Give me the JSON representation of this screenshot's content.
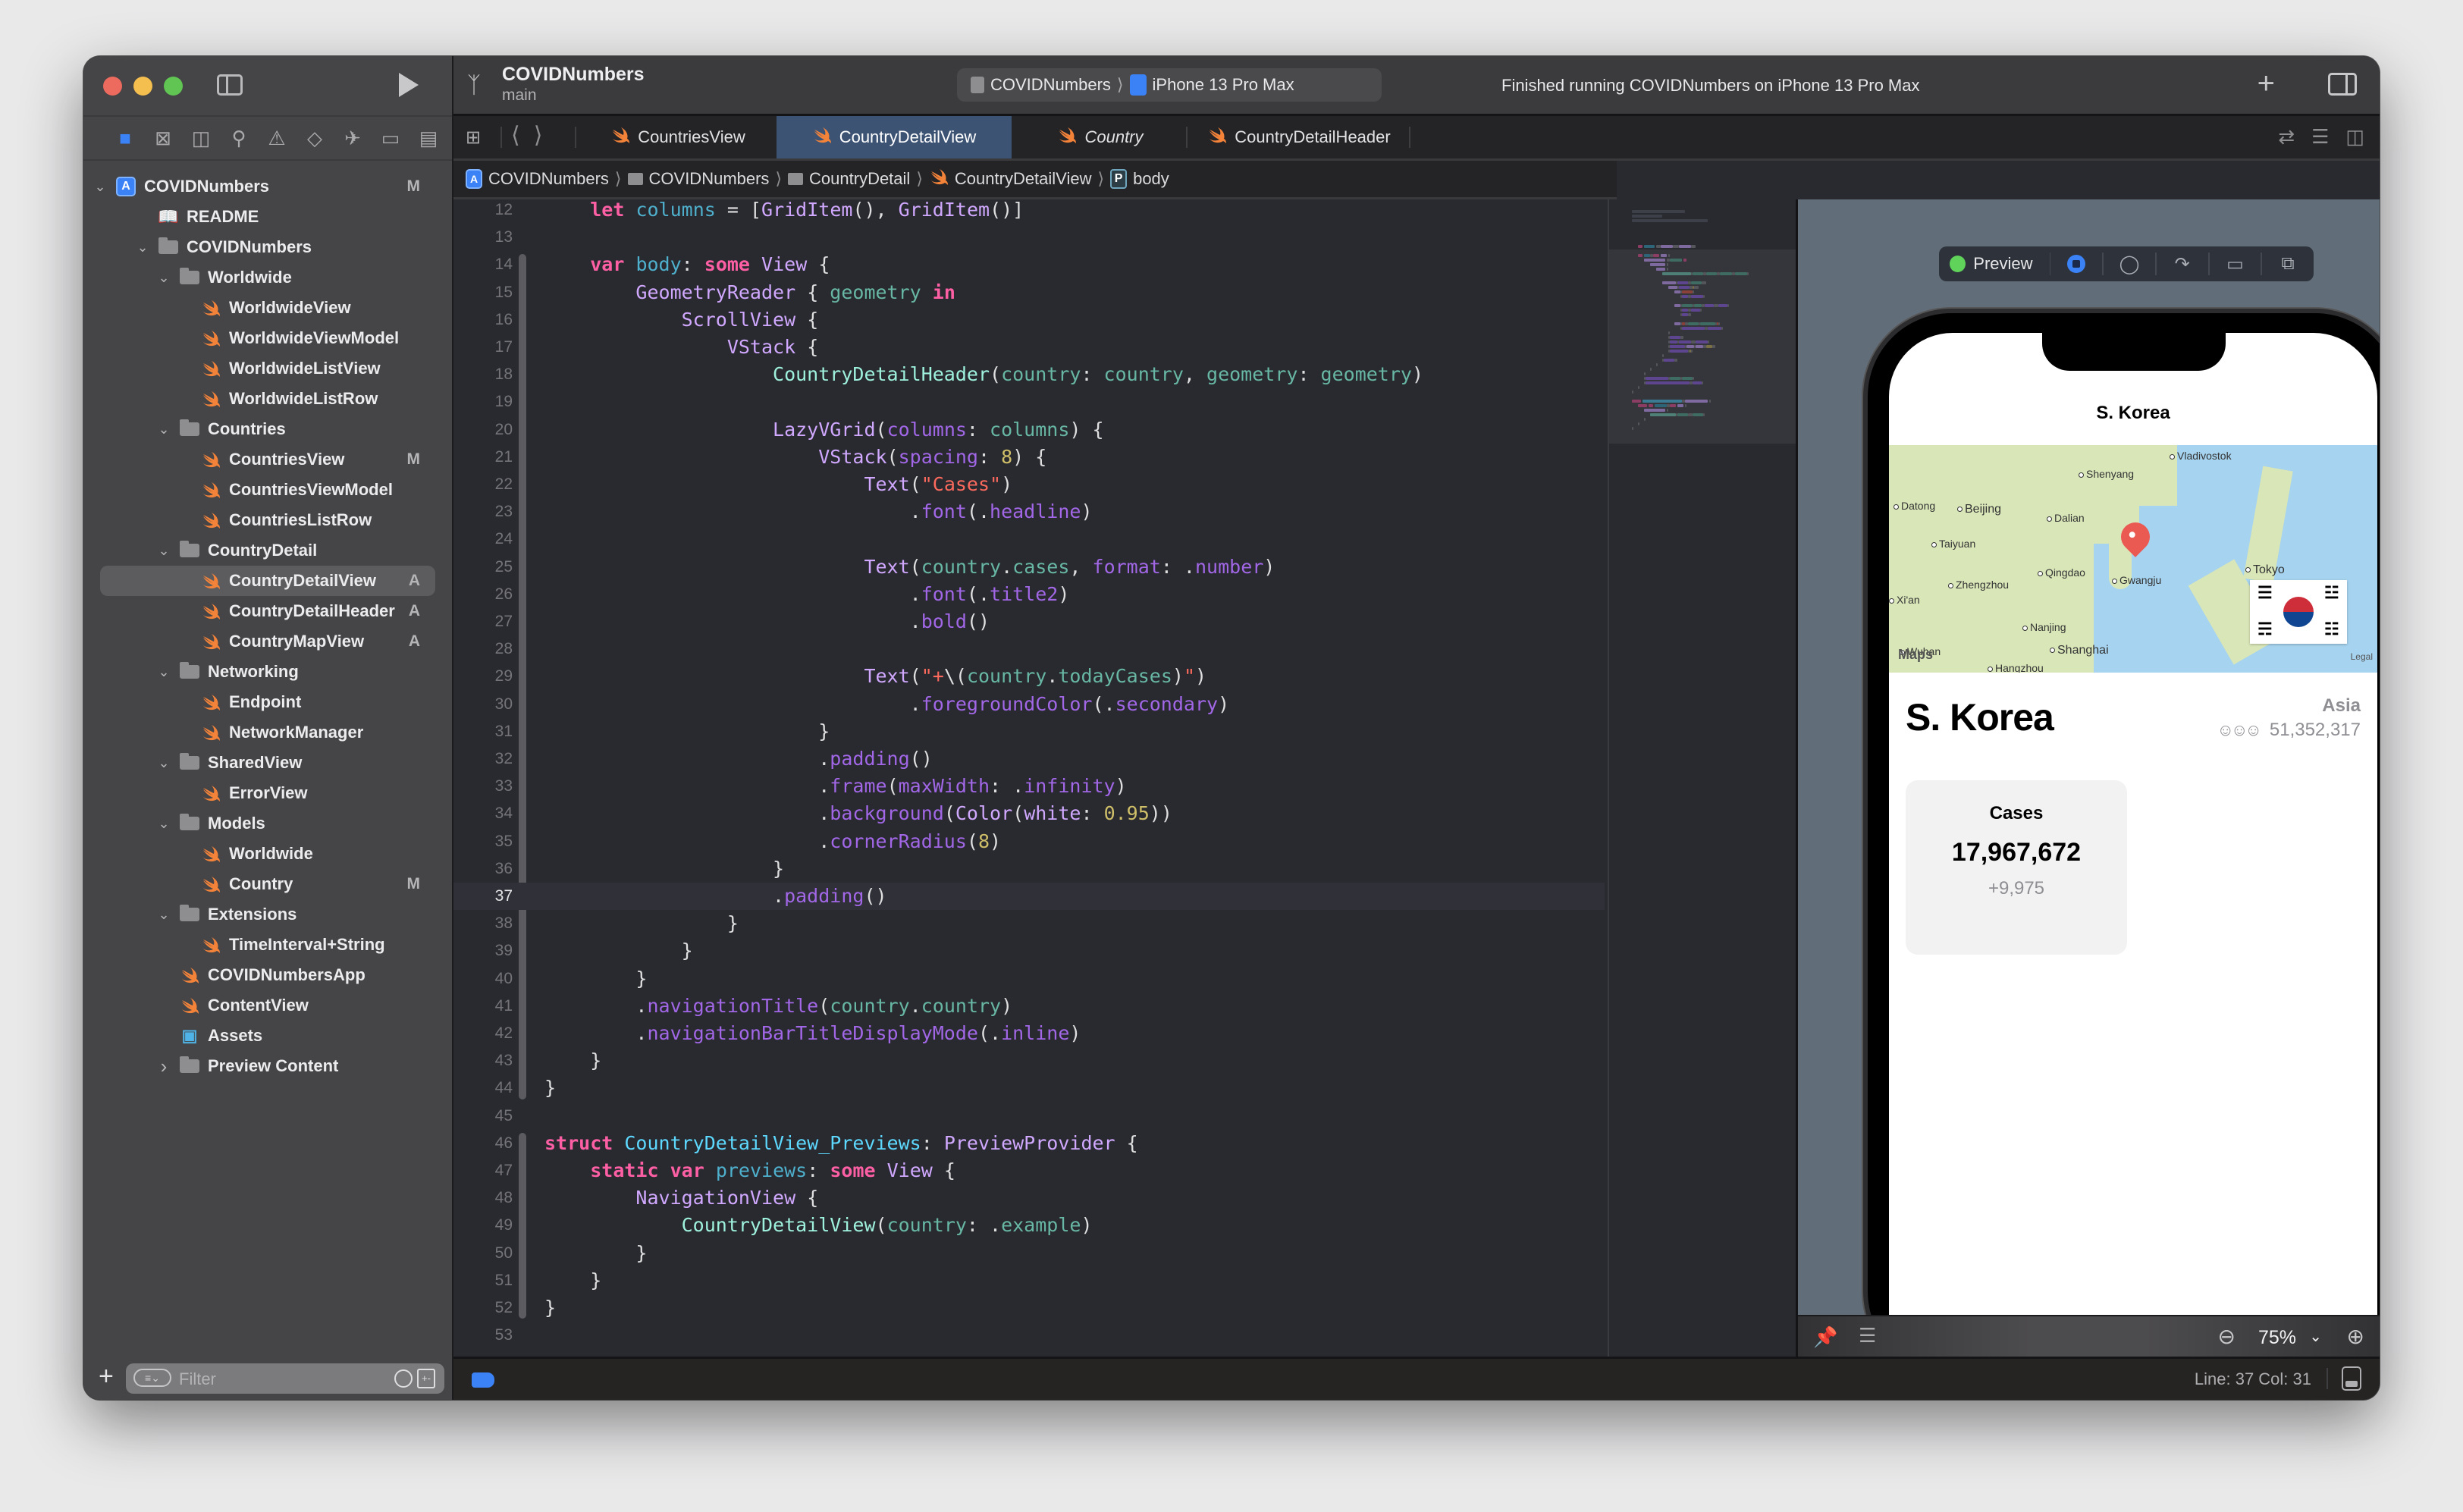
{
  "window": {
    "project_title": "COVIDNumbers",
    "branch": "main",
    "scheme": {
      "project": "COVIDNumbers",
      "device": "iPhone 13 Pro Max"
    },
    "activity_status": "Finished running COVIDNumbers on iPhone 13 Pro Max"
  },
  "navigator": {
    "icons": [
      "folder-icon",
      "source-control-icon",
      "symbol-icon",
      "find-icon",
      "issue-icon",
      "test-icon",
      "debug-icon",
      "breakpoint-icon",
      "report-icon"
    ],
    "tree": [
      {
        "label": "COVIDNumbers",
        "type": "project",
        "level": 0,
        "expanded": true,
        "badge": "M"
      },
      {
        "label": "README",
        "type": "book",
        "level": 1,
        "badge": ""
      },
      {
        "label": "COVIDNumbers",
        "type": "folder",
        "level": 1,
        "expanded": true,
        "badge": ""
      },
      {
        "label": "Worldwide",
        "type": "folder",
        "level": 2,
        "expanded": true,
        "badge": ""
      },
      {
        "label": "WorldwideView",
        "type": "swift",
        "level": 3,
        "badge": ""
      },
      {
        "label": "WorldwideViewModel",
        "type": "swift",
        "level": 3,
        "badge": ""
      },
      {
        "label": "WorldwideListView",
        "type": "swift",
        "level": 3,
        "badge": ""
      },
      {
        "label": "WorldwideListRow",
        "type": "swift",
        "level": 3,
        "badge": ""
      },
      {
        "label": "Countries",
        "type": "folder",
        "level": 2,
        "expanded": true,
        "badge": ""
      },
      {
        "label": "CountriesView",
        "type": "swift",
        "level": 3,
        "badge": "M"
      },
      {
        "label": "CountriesViewModel",
        "type": "swift",
        "level": 3,
        "badge": ""
      },
      {
        "label": "CountriesListRow",
        "type": "swift",
        "level": 3,
        "badge": ""
      },
      {
        "label": "CountryDetail",
        "type": "folder",
        "level": 2,
        "expanded": true,
        "badge": ""
      },
      {
        "label": "CountryDetailView",
        "type": "swift",
        "level": 3,
        "badge": "A",
        "selected": true
      },
      {
        "label": "CountryDetailHeader",
        "type": "swift",
        "level": 3,
        "badge": "A"
      },
      {
        "label": "CountryMapView",
        "type": "swift",
        "level": 3,
        "badge": "A"
      },
      {
        "label": "Networking",
        "type": "folder",
        "level": 2,
        "expanded": true,
        "badge": ""
      },
      {
        "label": "Endpoint",
        "type": "swift",
        "level": 3,
        "badge": ""
      },
      {
        "label": "NetworkManager",
        "type": "swift",
        "level": 3,
        "badge": ""
      },
      {
        "label": "SharedView",
        "type": "folder",
        "level": 2,
        "expanded": true,
        "badge": ""
      },
      {
        "label": "ErrorView",
        "type": "swift",
        "level": 3,
        "badge": ""
      },
      {
        "label": "Models",
        "type": "folder",
        "level": 2,
        "expanded": true,
        "badge": ""
      },
      {
        "label": "Worldwide",
        "type": "swift",
        "level": 3,
        "badge": ""
      },
      {
        "label": "Country",
        "type": "swift",
        "level": 3,
        "badge": "M"
      },
      {
        "label": "Extensions",
        "type": "folder",
        "level": 2,
        "expanded": true,
        "badge": ""
      },
      {
        "label": "TimeInterval+String",
        "type": "swift",
        "level": 3,
        "badge": ""
      },
      {
        "label": "COVIDNumbersApp",
        "type": "swift",
        "level": 2,
        "badge": ""
      },
      {
        "label": "ContentView",
        "type": "swift",
        "level": 2,
        "badge": ""
      },
      {
        "label": "Assets",
        "type": "assets",
        "level": 2,
        "badge": ""
      },
      {
        "label": "Preview Content",
        "type": "folder",
        "level": 2,
        "expanded": false,
        "badge": ""
      }
    ],
    "filter_placeholder": "Filter"
  },
  "tabs": [
    {
      "label": "CountriesView",
      "active": false,
      "italic": false
    },
    {
      "label": "CountryDetailView",
      "active": true,
      "italic": false
    },
    {
      "label": "Country",
      "active": false,
      "italic": true
    },
    {
      "label": "CountryDetailHeader",
      "active": false,
      "italic": false
    }
  ],
  "breadcrumb": [
    {
      "label": "COVIDNumbers",
      "type": "project"
    },
    {
      "label": "COVIDNumbers",
      "type": "folder"
    },
    {
      "label": "CountryDetail",
      "type": "folder"
    },
    {
      "label": "CountryDetailView",
      "type": "swift"
    },
    {
      "label": "body",
      "type": "property"
    }
  ],
  "editor": {
    "current_line": 37,
    "lines": [
      {
        "n": 12,
        "tokens": [
          [
            "",
            "    "
          ],
          [
            "kw",
            "let"
          ],
          [
            "",
            " "
          ],
          [
            "id",
            "columns"
          ],
          [
            "",
            " = ["
          ],
          [
            "tp",
            "GridItem"
          ],
          [
            "",
            "(), "
          ],
          [
            "tp",
            "GridItem"
          ],
          [
            "",
            "()]"
          ]
        ]
      },
      {
        "n": 13,
        "tokens": []
      },
      {
        "n": 14,
        "tokens": [
          [
            "",
            "    "
          ],
          [
            "kw",
            "var"
          ],
          [
            "",
            " "
          ],
          [
            "id",
            "body"
          ],
          [
            "",
            ": "
          ],
          [
            "kw",
            "some"
          ],
          [
            "",
            " "
          ],
          [
            "tp",
            "View"
          ],
          [
            "",
            " {"
          ]
        ]
      },
      {
        "n": 15,
        "tokens": [
          [
            "",
            "        "
          ],
          [
            "tp",
            "GeometryReader"
          ],
          [
            "",
            " { "
          ],
          [
            "pr",
            "geometry"
          ],
          [
            "",
            " "
          ],
          [
            "kw",
            "in"
          ]
        ]
      },
      {
        "n": 16,
        "tokens": [
          [
            "",
            "            "
          ],
          [
            "tp",
            "ScrollView"
          ],
          [
            "",
            " {"
          ]
        ]
      },
      {
        "n": 17,
        "tokens": [
          [
            "",
            "                "
          ],
          [
            "tp",
            "VStack"
          ],
          [
            "",
            " {"
          ]
        ]
      },
      {
        "n": 18,
        "tokens": [
          [
            "",
            "                    "
          ],
          [
            "pj",
            "CountryDetailHeader"
          ],
          [
            "",
            "("
          ],
          [
            "pr",
            "country"
          ],
          [
            "",
            ": "
          ],
          [
            "pr",
            "country"
          ],
          [
            "",
            ", "
          ],
          [
            "pr",
            "geometry"
          ],
          [
            "",
            ": "
          ],
          [
            "pr",
            "geometry"
          ],
          [
            "",
            ")"
          ]
        ]
      },
      {
        "n": 19,
        "tokens": []
      },
      {
        "n": 20,
        "tokens": [
          [
            "",
            "                    "
          ],
          [
            "tp",
            "LazyVGrid"
          ],
          [
            "",
            "("
          ],
          [
            "fn",
            "columns"
          ],
          [
            "",
            ": "
          ],
          [
            "pr",
            "columns"
          ],
          [
            "",
            ") {"
          ]
        ]
      },
      {
        "n": 21,
        "tokens": [
          [
            "",
            "                        "
          ],
          [
            "tp",
            "VStack"
          ],
          [
            "",
            "("
          ],
          [
            "fn",
            "spacing"
          ],
          [
            "",
            ": "
          ],
          [
            "nu",
            "8"
          ],
          [
            "",
            ") {"
          ]
        ]
      },
      {
        "n": 22,
        "tokens": [
          [
            "",
            "                            "
          ],
          [
            "tp",
            "Text"
          ],
          [
            "",
            "("
          ],
          [
            "st",
            "\"Cases\""
          ],
          [
            "",
            ")"
          ]
        ]
      },
      {
        "n": 23,
        "tokens": [
          [
            "",
            "                                ."
          ],
          [
            "fn",
            "font"
          ],
          [
            "",
            "(."
          ],
          [
            "fn",
            "headline"
          ],
          [
            "",
            ")"
          ]
        ]
      },
      {
        "n": 24,
        "tokens": []
      },
      {
        "n": 25,
        "tokens": [
          [
            "",
            "                            "
          ],
          [
            "tp",
            "Text"
          ],
          [
            "",
            "("
          ],
          [
            "pr",
            "country"
          ],
          [
            "",
            "."
          ],
          [
            "pr",
            "cases"
          ],
          [
            "",
            ", "
          ],
          [
            "fn",
            "format"
          ],
          [
            "",
            ": ."
          ],
          [
            "fn",
            "number"
          ],
          [
            "",
            ")"
          ]
        ]
      },
      {
        "n": 26,
        "tokens": [
          [
            "",
            "                                ."
          ],
          [
            "fn",
            "font"
          ],
          [
            "",
            "(."
          ],
          [
            "fn",
            "title2"
          ],
          [
            "",
            ")"
          ]
        ]
      },
      {
        "n": 27,
        "tokens": [
          [
            "",
            "                                ."
          ],
          [
            "fn",
            "bold"
          ],
          [
            "",
            "()"
          ]
        ]
      },
      {
        "n": 28,
        "tokens": []
      },
      {
        "n": 29,
        "tokens": [
          [
            "",
            "                            "
          ],
          [
            "tp",
            "Text"
          ],
          [
            "",
            "("
          ],
          [
            "st",
            "\"+"
          ],
          [
            "",
            "\\("
          ],
          [
            "pr",
            "country"
          ],
          [
            "",
            "."
          ],
          [
            "pr",
            "todayCases"
          ],
          [
            "",
            ")"
          ],
          [
            "st",
            "\""
          ],
          [
            "",
            ")"
          ]
        ]
      },
      {
        "n": 30,
        "tokens": [
          [
            "",
            "                                ."
          ],
          [
            "fn",
            "foregroundColor"
          ],
          [
            "",
            "(."
          ],
          [
            "fn",
            "secondary"
          ],
          [
            "",
            ")"
          ]
        ]
      },
      {
        "n": 31,
        "tokens": [
          [
            "",
            "                        }"
          ]
        ]
      },
      {
        "n": 32,
        "tokens": [
          [
            "",
            "                        ."
          ],
          [
            "fn",
            "padding"
          ],
          [
            "",
            "()"
          ]
        ]
      },
      {
        "n": 33,
        "tokens": [
          [
            "",
            "                        ."
          ],
          [
            "fn",
            "frame"
          ],
          [
            "",
            "("
          ],
          [
            "fn",
            "maxWidth"
          ],
          [
            "",
            ": ."
          ],
          [
            "fn",
            "infinity"
          ],
          [
            "",
            ")"
          ]
        ]
      },
      {
        "n": 34,
        "tokens": [
          [
            "",
            "                        ."
          ],
          [
            "fn",
            "background"
          ],
          [
            "",
            "("
          ],
          [
            "tp",
            "Color"
          ],
          [
            "",
            "("
          ],
          [
            "tp",
            "white"
          ],
          [
            "",
            ": "
          ],
          [
            "nu",
            "0.95"
          ],
          [
            "",
            "))"
          ]
        ]
      },
      {
        "n": 35,
        "tokens": [
          [
            "",
            "                        ."
          ],
          [
            "fn",
            "cornerRadius"
          ],
          [
            "",
            "("
          ],
          [
            "nu",
            "8"
          ],
          [
            "",
            ")"
          ]
        ]
      },
      {
        "n": 36,
        "tokens": [
          [
            "",
            "                    }"
          ]
        ]
      },
      {
        "n": 37,
        "tokens": [
          [
            "",
            "                    ."
          ],
          [
            "fn",
            "padding"
          ],
          [
            "",
            "()"
          ]
        ]
      },
      {
        "n": 38,
        "tokens": [
          [
            "",
            "                }"
          ]
        ]
      },
      {
        "n": 39,
        "tokens": [
          [
            "",
            "            }"
          ]
        ]
      },
      {
        "n": 40,
        "tokens": [
          [
            "",
            "        }"
          ]
        ]
      },
      {
        "n": 41,
        "tokens": [
          [
            "",
            "        ."
          ],
          [
            "fn",
            "navigationTitle"
          ],
          [
            "",
            "("
          ],
          [
            "pr",
            "country"
          ],
          [
            "",
            "."
          ],
          [
            "pr",
            "country"
          ],
          [
            "",
            ")"
          ]
        ]
      },
      {
        "n": 42,
        "tokens": [
          [
            "",
            "        ."
          ],
          [
            "fn",
            "navigationBarTitleDisplayMode"
          ],
          [
            "",
            "(."
          ],
          [
            "fn",
            "inline"
          ],
          [
            "",
            ")"
          ]
        ]
      },
      {
        "n": 43,
        "tokens": [
          [
            "",
            "    }"
          ]
        ]
      },
      {
        "n": 44,
        "tokens": [
          [
            "",
            "}"
          ]
        ]
      },
      {
        "n": 45,
        "tokens": []
      },
      {
        "n": 46,
        "tokens": [
          [
            "kw",
            "struct"
          ],
          [
            "",
            " "
          ],
          [
            "cl",
            "CountryDetailView_Previews"
          ],
          [
            "",
            ": "
          ],
          [
            "tp",
            "PreviewProvider"
          ],
          [
            "",
            " {"
          ]
        ]
      },
      {
        "n": 47,
        "tokens": [
          [
            "",
            "    "
          ],
          [
            "kw",
            "static"
          ],
          [
            "",
            " "
          ],
          [
            "kw",
            "var"
          ],
          [
            "",
            " "
          ],
          [
            "id",
            "previews"
          ],
          [
            "",
            ": "
          ],
          [
            "kw",
            "some"
          ],
          [
            "",
            " "
          ],
          [
            "tp",
            "View"
          ],
          [
            "",
            " {"
          ]
        ]
      },
      {
        "n": 48,
        "tokens": [
          [
            "",
            "        "
          ],
          [
            "tp",
            "NavigationView"
          ],
          [
            "",
            " {"
          ]
        ]
      },
      {
        "n": 49,
        "tokens": [
          [
            "",
            "            "
          ],
          [
            "pj",
            "CountryDetailView"
          ],
          [
            "",
            "("
          ],
          [
            "pr",
            "country"
          ],
          [
            "",
            ": ."
          ],
          [
            "pr",
            "example"
          ],
          [
            "",
            ")"
          ]
        ]
      },
      {
        "n": 50,
        "tokens": [
          [
            "",
            "        }"
          ]
        ]
      },
      {
        "n": 51,
        "tokens": [
          [
            "",
            "    }"
          ]
        ]
      },
      {
        "n": 52,
        "tokens": [
          [
            "",
            "}"
          ]
        ]
      },
      {
        "n": 53,
        "tokens": []
      }
    ]
  },
  "preview": {
    "label": "Preview",
    "zoom": "75%",
    "app": {
      "nav_title": "S. Korea",
      "country": "S. Korea",
      "continent": "Asia",
      "population": "51,352,317",
      "map_cities": [
        "Vladivostok",
        "Shenyang",
        "Datong",
        "Beijing",
        "Dalian",
        "Taiyuan",
        "Qingdao",
        "Gwangju",
        "Tokyo",
        "Zhengzhou",
        "Xi'an",
        "Nanjing",
        "Shanghai",
        "Wuhan",
        "Hangzhou"
      ],
      "map_logo": "Maps",
      "map_legal": "Legal",
      "cards": [
        {
          "title": "Cases",
          "value": "17,967,672",
          "delta": "+9,975"
        }
      ]
    }
  },
  "status": {
    "line_col": "Line: 37  Col: 31"
  }
}
